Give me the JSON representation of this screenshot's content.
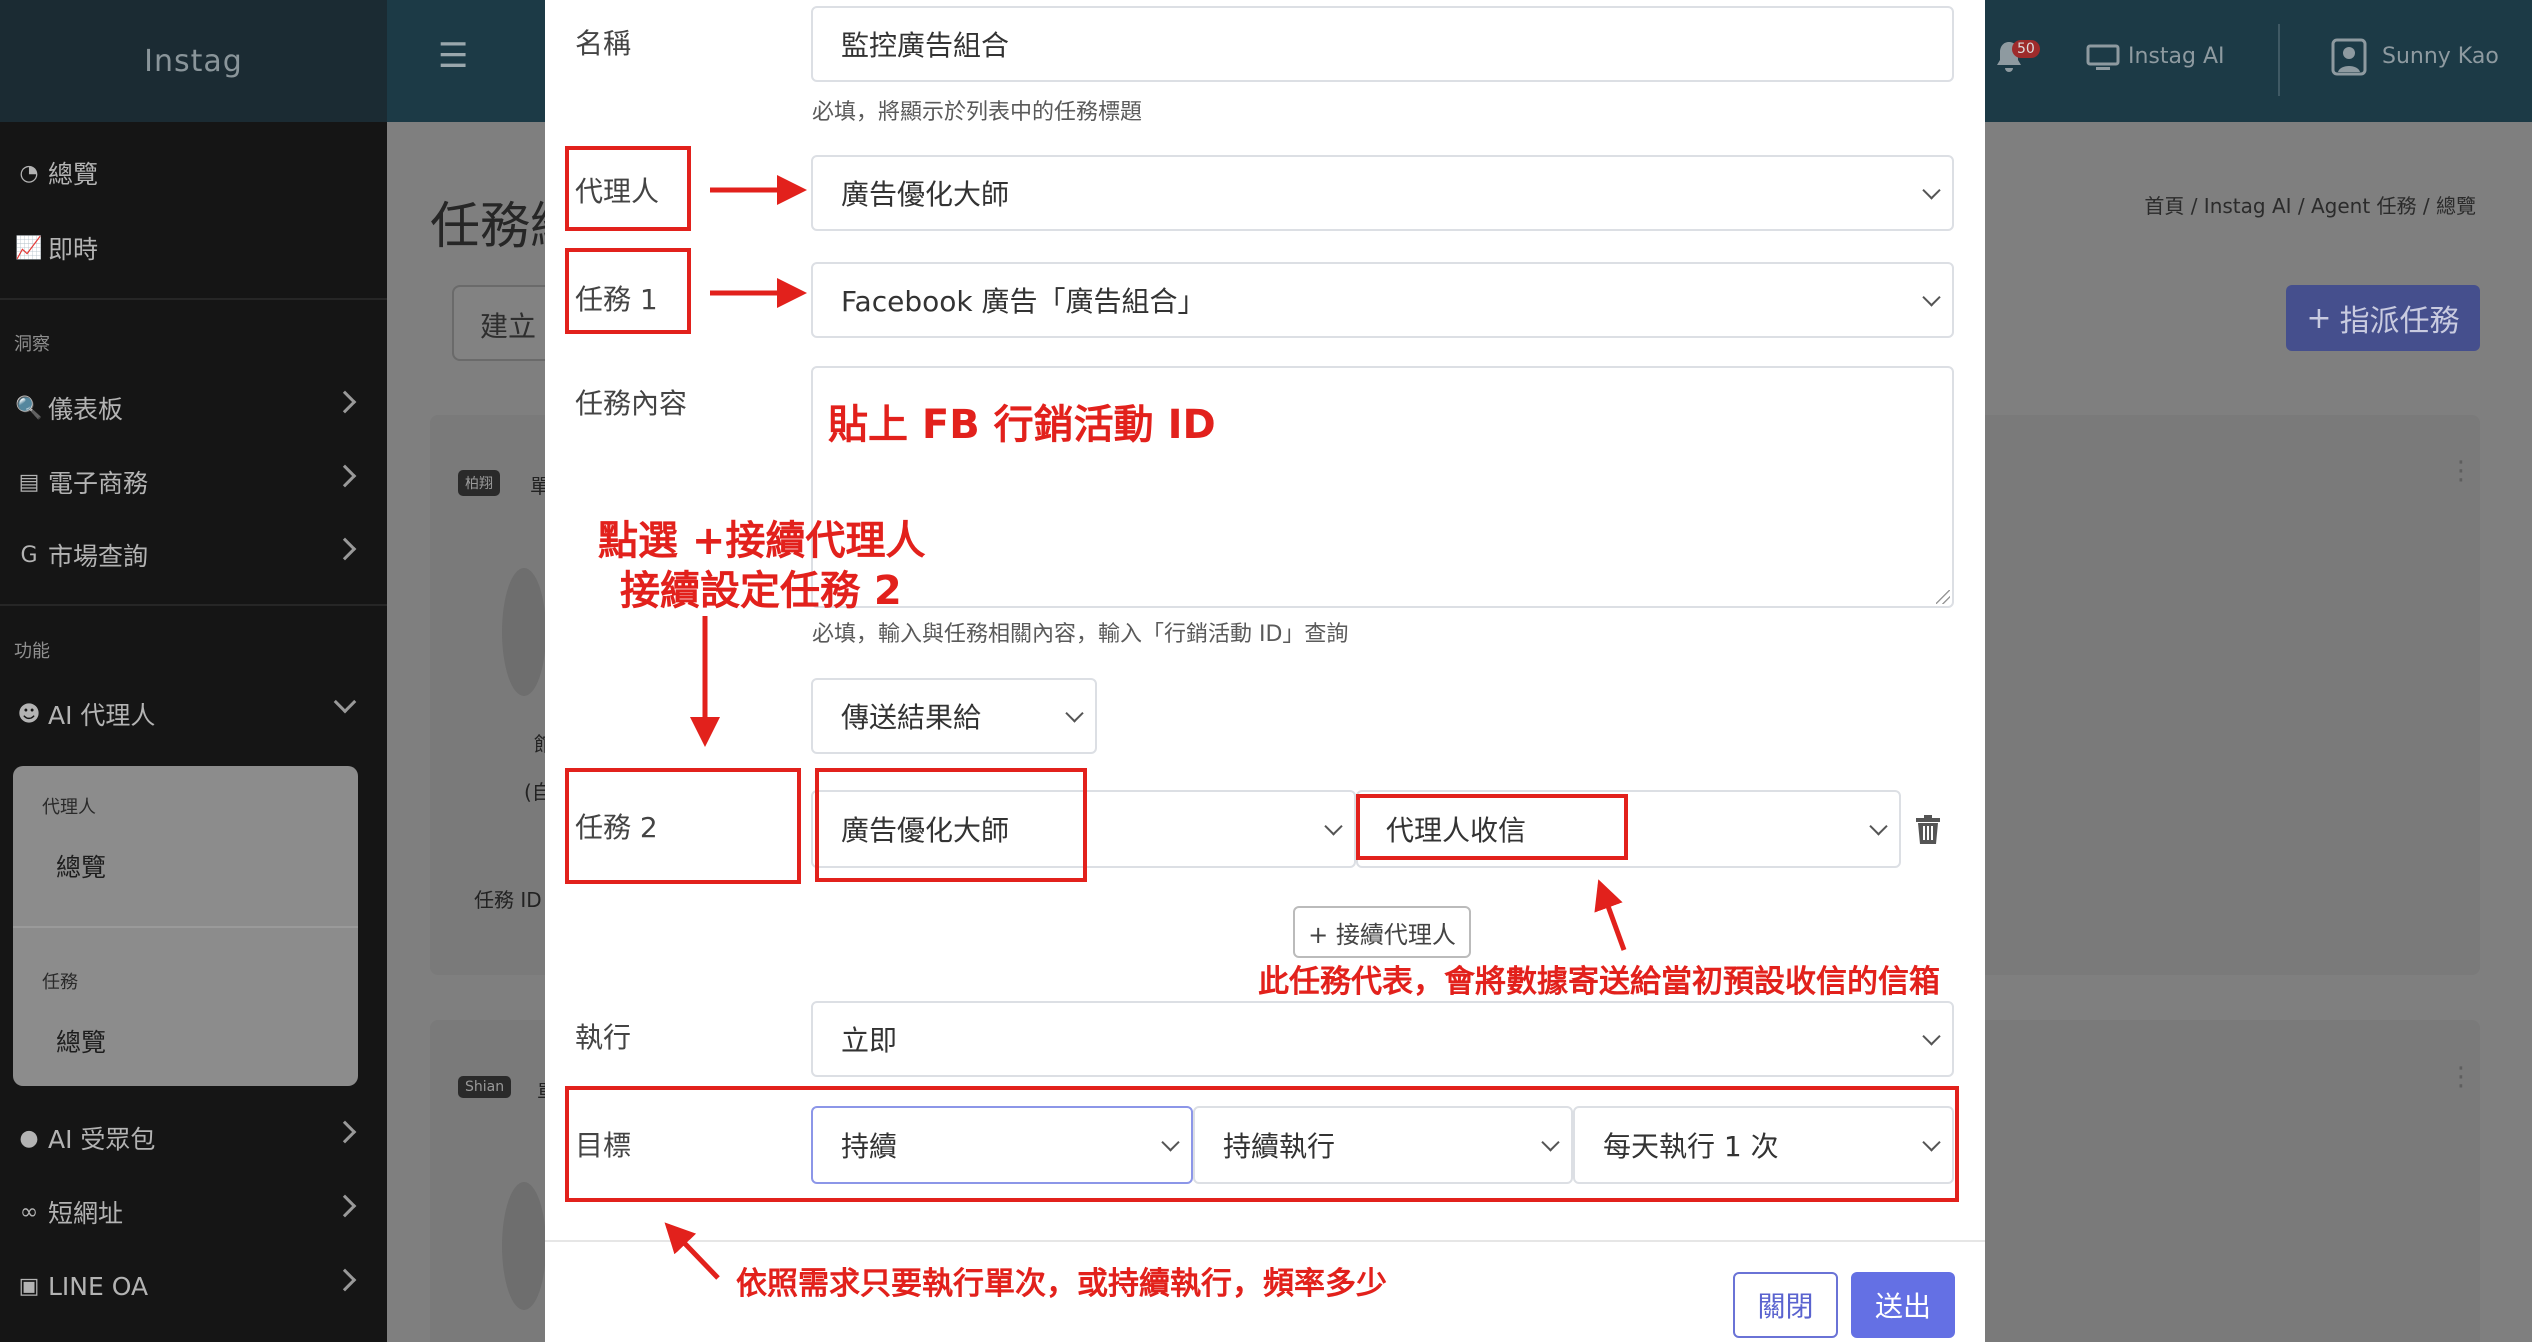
{
  "app": {
    "brand": "Instag",
    "topbar": {
      "ai_link": "Instag AI",
      "user": "Sunny Kao",
      "notif_count": "50"
    }
  },
  "sidebar": {
    "items_top": [
      {
        "icon": "gauge-icon",
        "label": "總覽"
      },
      {
        "icon": "chart-line-icon",
        "label": "即時"
      }
    ],
    "section_insight": "洞察",
    "items_insight": [
      {
        "icon": "search-chart-icon",
        "label": "儀表板"
      },
      {
        "icon": "store-icon",
        "label": "電子商務"
      },
      {
        "icon": "google-icon",
        "label": "市場查詢"
      }
    ],
    "section_function": "功能",
    "ai_agent": {
      "icon": "robot-icon",
      "label": "AI 代理人"
    },
    "sub_agent_head": "代理人",
    "sub_agent_overview": "總覽",
    "sub_task_head": "任務",
    "sub_task_overview": "總覽",
    "items_bottom": [
      {
        "icon": "user-group-icon",
        "label": "AI 受眾包"
      },
      {
        "icon": "link-icon",
        "label": "短網址"
      },
      {
        "icon": "line-icon",
        "label": "LINE OA"
      }
    ]
  },
  "page": {
    "title": "任務總",
    "breadcrumb": "首頁 / Instag AI / Agent 任務 / 總覽",
    "assign_button": "指派任務",
    "create_button": "建立",
    "card1_tag": "柏翔",
    "card1_fragment": "單",
    "card1_name": "館",
    "card1_sub": "(自",
    "card1_task_id": "任務 ID",
    "card2_tag": "Shian",
    "card2_fragment": "單"
  },
  "modal": {
    "name_label": "名稱",
    "name_value": "監控廣告組合",
    "name_help": "必填，將顯示於列表中的任務標題",
    "agent_label": "代理人",
    "agent_value": "廣告優化大師",
    "task1_label": "任務 1",
    "task1_value": "Facebook 廣告「廣告組合」",
    "content_label": "任務內容",
    "content_help": "必填，輸入與任務相關內容，輸入「行銷活動 ID」查詢",
    "send_result_value": "傳送結果給",
    "task2_label": "任務 2",
    "task2_agent_value": "廣告優化大師",
    "task2_recipient_value": "代理人收信",
    "continue_button": "+ 接續代理人",
    "run_label": "執行",
    "run_value": "立即",
    "goal_label": "目標",
    "goal_mode_value": "持續",
    "goal_run_value": "持續執行",
    "goal_freq_value": "每天執行 1 次",
    "close_button": "關閉",
    "submit_button": "送出"
  },
  "annotations": {
    "paste_id": "貼上 FB 行銷活動 ID",
    "continue_line1": "點選 +接續代理人",
    "continue_line2": "接續設定任務 2",
    "mailbox_note": "此任務代表，會將數據寄送給當初預設收信的信箱",
    "frequency_note": "依照需求只要執行單次，或持續執行，頻率多少"
  },
  "colors": {
    "annotation_red": "#e2211c",
    "primary": "#6470e4",
    "sidebar_bg": "#151515",
    "topbar_bg": "#1c3a46"
  }
}
